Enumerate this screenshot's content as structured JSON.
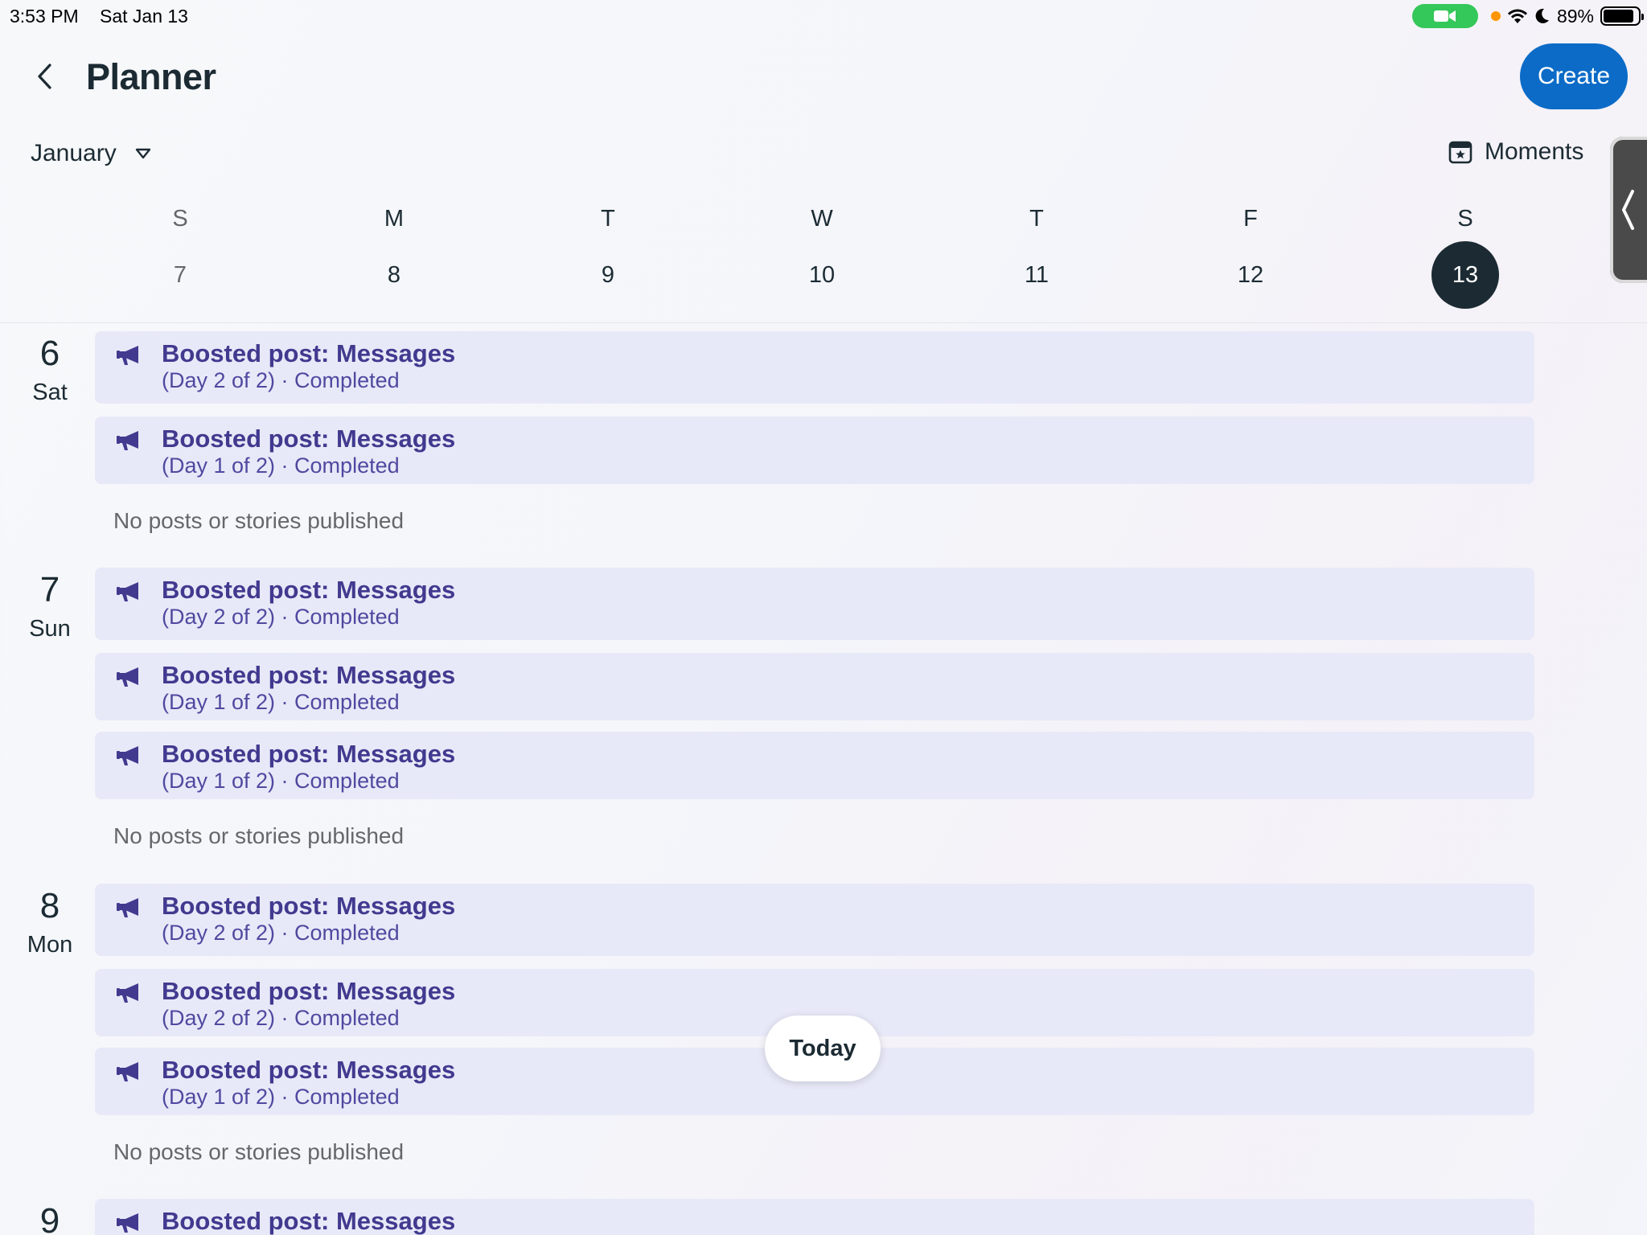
{
  "status_bar": {
    "time": "3:53 PM",
    "date": "Sat Jan 13",
    "battery_pct": "89%",
    "battery_level": 0.89,
    "facetime_color": "#34c759",
    "privacy_dot_color": "#ff9500"
  },
  "header": {
    "title": "Planner",
    "create_label": "Create",
    "accent": "#0b6bc7"
  },
  "toolbar": {
    "month": "January",
    "moments_label": "Moments"
  },
  "week": {
    "days": [
      {
        "dow": "S",
        "date": "7"
      },
      {
        "dow": "M",
        "date": "8"
      },
      {
        "dow": "T",
        "date": "9"
      },
      {
        "dow": "W",
        "date": "10"
      },
      {
        "dow": "T",
        "date": "11"
      },
      {
        "dow": "F",
        "date": "12"
      },
      {
        "dow": "S",
        "date": "13"
      }
    ],
    "selected_date": "13"
  },
  "agenda": {
    "empty_note": "No posts or stories published",
    "days": [
      {
        "num": "6",
        "name": "Sat",
        "events": [
          {
            "title": "Boosted post: Messages",
            "sub": "(Day 2 of 2) · Completed"
          },
          {
            "title": "Boosted post: Messages",
            "sub": "(Day 1 of 2) · Completed"
          }
        ]
      },
      {
        "num": "7",
        "name": "Sun",
        "events": [
          {
            "title": "Boosted post: Messages",
            "sub": "(Day 2 of 2) · Completed"
          },
          {
            "title": "Boosted post: Messages",
            "sub": "(Day 1 of 2) · Completed"
          },
          {
            "title": "Boosted post: Messages",
            "sub": "(Day 1 of 2) · Completed"
          }
        ]
      },
      {
        "num": "8",
        "name": "Mon",
        "events": [
          {
            "title": "Boosted post: Messages",
            "sub": "(Day 2 of 2) · Completed"
          },
          {
            "title": "Boosted post: Messages",
            "sub": "(Day 2 of 2) · Completed"
          },
          {
            "title": "Boosted post: Messages",
            "sub": "(Day 1 of 2) · Completed"
          }
        ]
      },
      {
        "num": "9",
        "name": "",
        "events": [
          {
            "title": "Boosted post: Messages",
            "sub": ""
          }
        ]
      }
    ]
  },
  "today_label": "Today",
  "colors": {
    "event_bg": "#e8e9f8",
    "event_text": "#413a8f",
    "selected_day_bg": "#1c2b33"
  }
}
